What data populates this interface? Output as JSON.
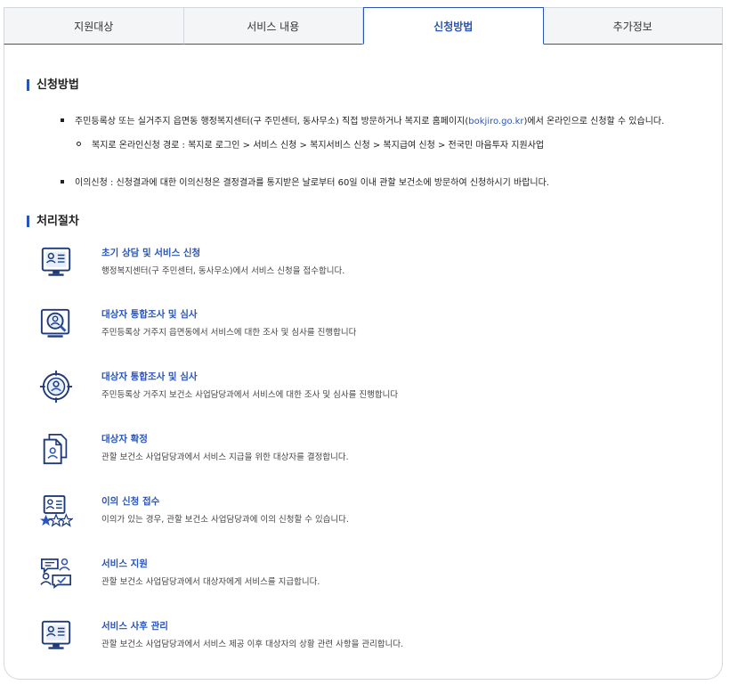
{
  "tabs": [
    {
      "label": "지원대상"
    },
    {
      "label": "서비스 내용"
    },
    {
      "label": "신청방법"
    },
    {
      "label": "추가정보"
    }
  ],
  "apply": {
    "title": "신청방법",
    "item1_pre": "주민등록상 또는 실거주지 읍면동 행정복지센터(구 주민센터, 동사무소) 직접 방문하거나 복지로 홈페이지(",
    "item1_link": "bokjiro.go.kr",
    "item1_post": ")에서 온라인으로 신청할 수 있습니다.",
    "sub1": "복지로 온라인신청 경로 : 복지로 로그인 > 서비스 신청 > 복지서비스 신청 > 복지급여 신청 > 전국민 마음투자 지원사업",
    "item2": "이의신청 : 신청결과에 대한 이의신청은 결정결과를 통지받은 날로부터 60일 이내 관할 보건소에 방문하여 신청하시기 바랍니다."
  },
  "process": {
    "title": "처리절차",
    "steps": [
      {
        "icon": "monitor-profile-icon",
        "title": "초기 상담 및 서비스 신청",
        "desc": "행정복지센터(구 주민센터, 동사무소)에서 서비스 신청을 접수합니다."
      },
      {
        "icon": "magnifier-person-icon",
        "title": "대상자 통합조사 및 심사",
        "desc": "주민등록상 거주지 읍면동에서 서비스에 대한 조사 및 심사를 진행합니다"
      },
      {
        "icon": "target-person-icon",
        "title": "대상자 통합조사 및 심사",
        "desc": "주민등록상 거주지 보건소 사업담당과에서 서비스에 대한 조사 및 심사를 진행합니다"
      },
      {
        "icon": "document-person-icon",
        "title": "대상자 확정",
        "desc": "관할 보건소 사업담당과에서 서비스 지급을 위한 대상자를 결정합니다."
      },
      {
        "icon": "profile-stars-icon",
        "title": "이의 신청 접수",
        "desc": "이의가 있는 경우, 관할 보건소 사업담당과에 이의 신청할 수 있습니다."
      },
      {
        "icon": "people-chat-icon",
        "title": "서비스 지원",
        "desc": "관할 보건소 사업담당과에서 대상자에게 서비스를 지급합니다."
      },
      {
        "icon": "monitor-profile-icon",
        "title": "서비스 사후 관리",
        "desc": "관할 보건소 사업담당과에서 서비스 제공 이후 대상자의 상황 관련 사항을 관리합니다."
      }
    ]
  },
  "colors": {
    "accent": "#2a55b8",
    "icon_navy": "#1e3a7a"
  }
}
